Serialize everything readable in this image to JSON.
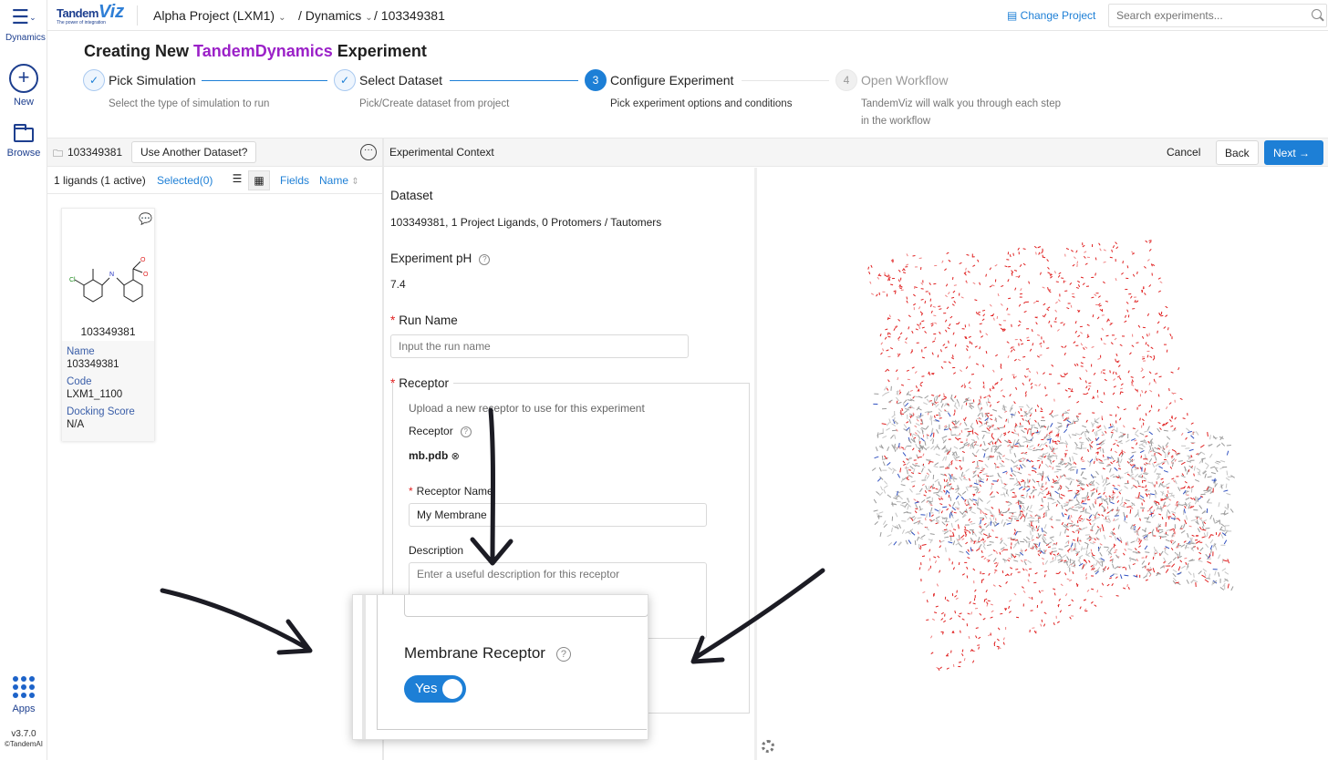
{
  "rail": {
    "menu_label": "Dynamics",
    "new_label": "New",
    "browse_label": "Browse",
    "apps_label": "Apps",
    "version": "v3.7.0",
    "copyright": "©TandemAI"
  },
  "topbar": {
    "logo_part1": "Tandem",
    "logo_part2": "Viz",
    "logo_tagline": "The power of integration",
    "project": "Alpha Project (LXM1)",
    "module": "/ Dynamics",
    "experiment_id": "/ 103349381",
    "change_project": "Change Project",
    "search_placeholder": "Search experiments..."
  },
  "heading": {
    "prefix": "Creating New",
    "accent": "TandemDynamics",
    "suffix": "Experiment"
  },
  "steps": [
    {
      "num": "✓",
      "title": "Pick Simulation",
      "desc": "Select the type of simulation to run",
      "state": "done"
    },
    {
      "num": "✓",
      "title": "Select Dataset",
      "desc": "Pick/Create dataset from project",
      "state": "done"
    },
    {
      "num": "3",
      "title": "Configure Experiment",
      "desc": "Pick experiment options and conditions",
      "state": "active"
    },
    {
      "num": "4",
      "title": "Open Workflow",
      "desc": "TandemViz will walk you through each step in the workflow",
      "state": "todo"
    }
  ],
  "left_panel": {
    "dataset_name": "103349381",
    "use_another": "Use Another Dataset?",
    "ligand_count": "1 ligands (1 active)",
    "selected": "Selected(0)",
    "fields": "Fields",
    "sort": "Name",
    "card": {
      "id": "103349381",
      "name_key": "Name",
      "name_val": "103349381",
      "code_key": "Code",
      "code_val": "LXM1_1100",
      "dock_key": "Docking Score",
      "dock_val": "N/A"
    }
  },
  "right_bar": {
    "title": "Experimental Context",
    "cancel": "Cancel",
    "back": "Back",
    "next": "Next →"
  },
  "form": {
    "dataset_label": "Dataset",
    "dataset_value": "103349381, 1 Project Ligands, 0 Protomers / Tautomers",
    "ph_label": "Experiment pH",
    "ph_value": "7.4",
    "run_name_label": "Run Name",
    "run_name_placeholder": "Input the run name",
    "receptor_section": "Receptor",
    "receptor_help": "Upload a new receptor to use for this experiment",
    "receptor_label": "Receptor",
    "receptor_file": "mb.pdb",
    "receptor_name_label": "Receptor Name",
    "receptor_name_value": "My Membrane",
    "description_label": "Description",
    "description_placeholder": "Enter a useful description for this receptor"
  },
  "zoom": {
    "membrane_label": "Membrane Receptor",
    "toggle_label": "Yes",
    "toggle_on": true
  },
  "colors": {
    "accent": "#1d7fd6",
    "brand_purple": "#9b21c8",
    "oxygen": "#e02020",
    "carbon": "#8a8a8a"
  }
}
